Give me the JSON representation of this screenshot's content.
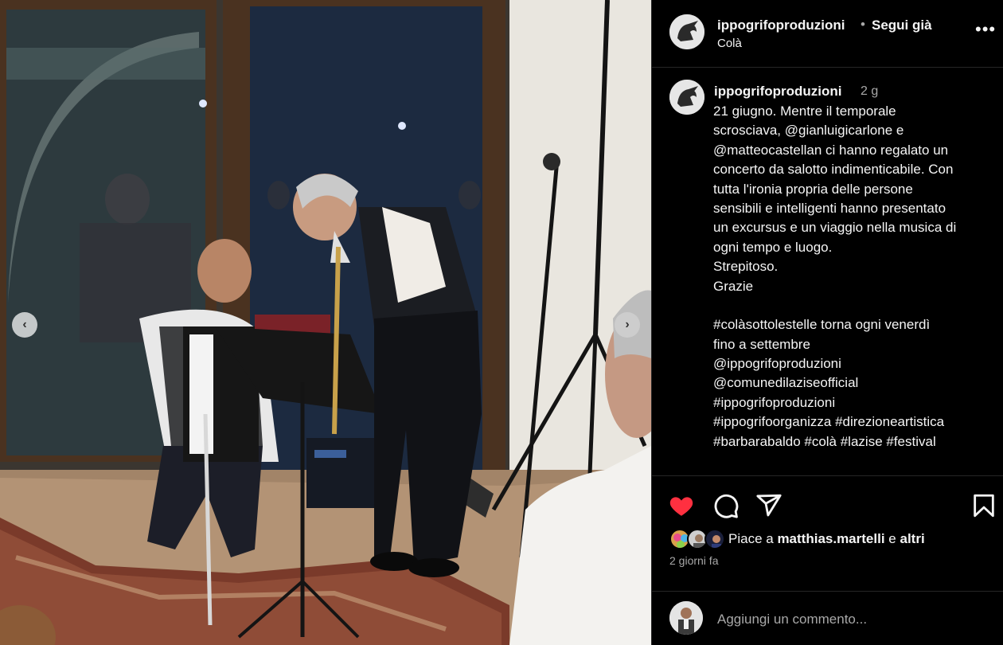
{
  "colors": {
    "background": "#000000",
    "text": "#f5f5f5",
    "secondary_text": "#a8a8a8",
    "like_red": "#ff3040",
    "divider": "#262626"
  },
  "photo": {
    "prev_icon": "chevron-left-icon",
    "next_icon": "chevron-right-icon",
    "prev_glyph": "‹",
    "next_glyph": "›"
  },
  "header": {
    "username": "ippogrifoproduzioni",
    "separator": "•",
    "follow_status": "Segui già",
    "location": "Colà",
    "more_glyph": "•••"
  },
  "caption": {
    "username": "ippogrifoproduzioni",
    "time": "2 g",
    "lines": [
      "21 giugno. Mentre il temporale",
      "scrosciava, @gianluigicarlone e",
      "@matteocastellan ci hanno regalato un",
      "concerto da salotto indimenticabile. Con",
      "tutta l'ironia propria delle persone",
      "sensibili e intelligenti hanno presentato",
      "un excursus e un viaggio nella musica di",
      "ogni tempo e luogo.",
      "Strepitoso.",
      "Grazie",
      "",
      "#colàsottolestelle torna ogni venerdì",
      "fino a settembre",
      "@ippogrifoproduzioni",
      "@comunedilaziseofficial",
      "#ippogrifoproduzioni",
      "#ippogrifoorganizza #direzioneartistica",
      "#barbarabaldo #colà #lazise #festival"
    ]
  },
  "actions": {
    "like_icon": "heart-filled-icon",
    "comment_icon": "comment-bubble-icon",
    "share_icon": "paper-plane-icon",
    "save_icon": "bookmark-icon",
    "liked": true
  },
  "likes": {
    "prefix": "Piace a",
    "user": "matthias.martelli",
    "conjunction": "e",
    "others": "altri"
  },
  "post_date": "2 giorni fa",
  "comment": {
    "placeholder": "Aggiungi un commento..."
  }
}
